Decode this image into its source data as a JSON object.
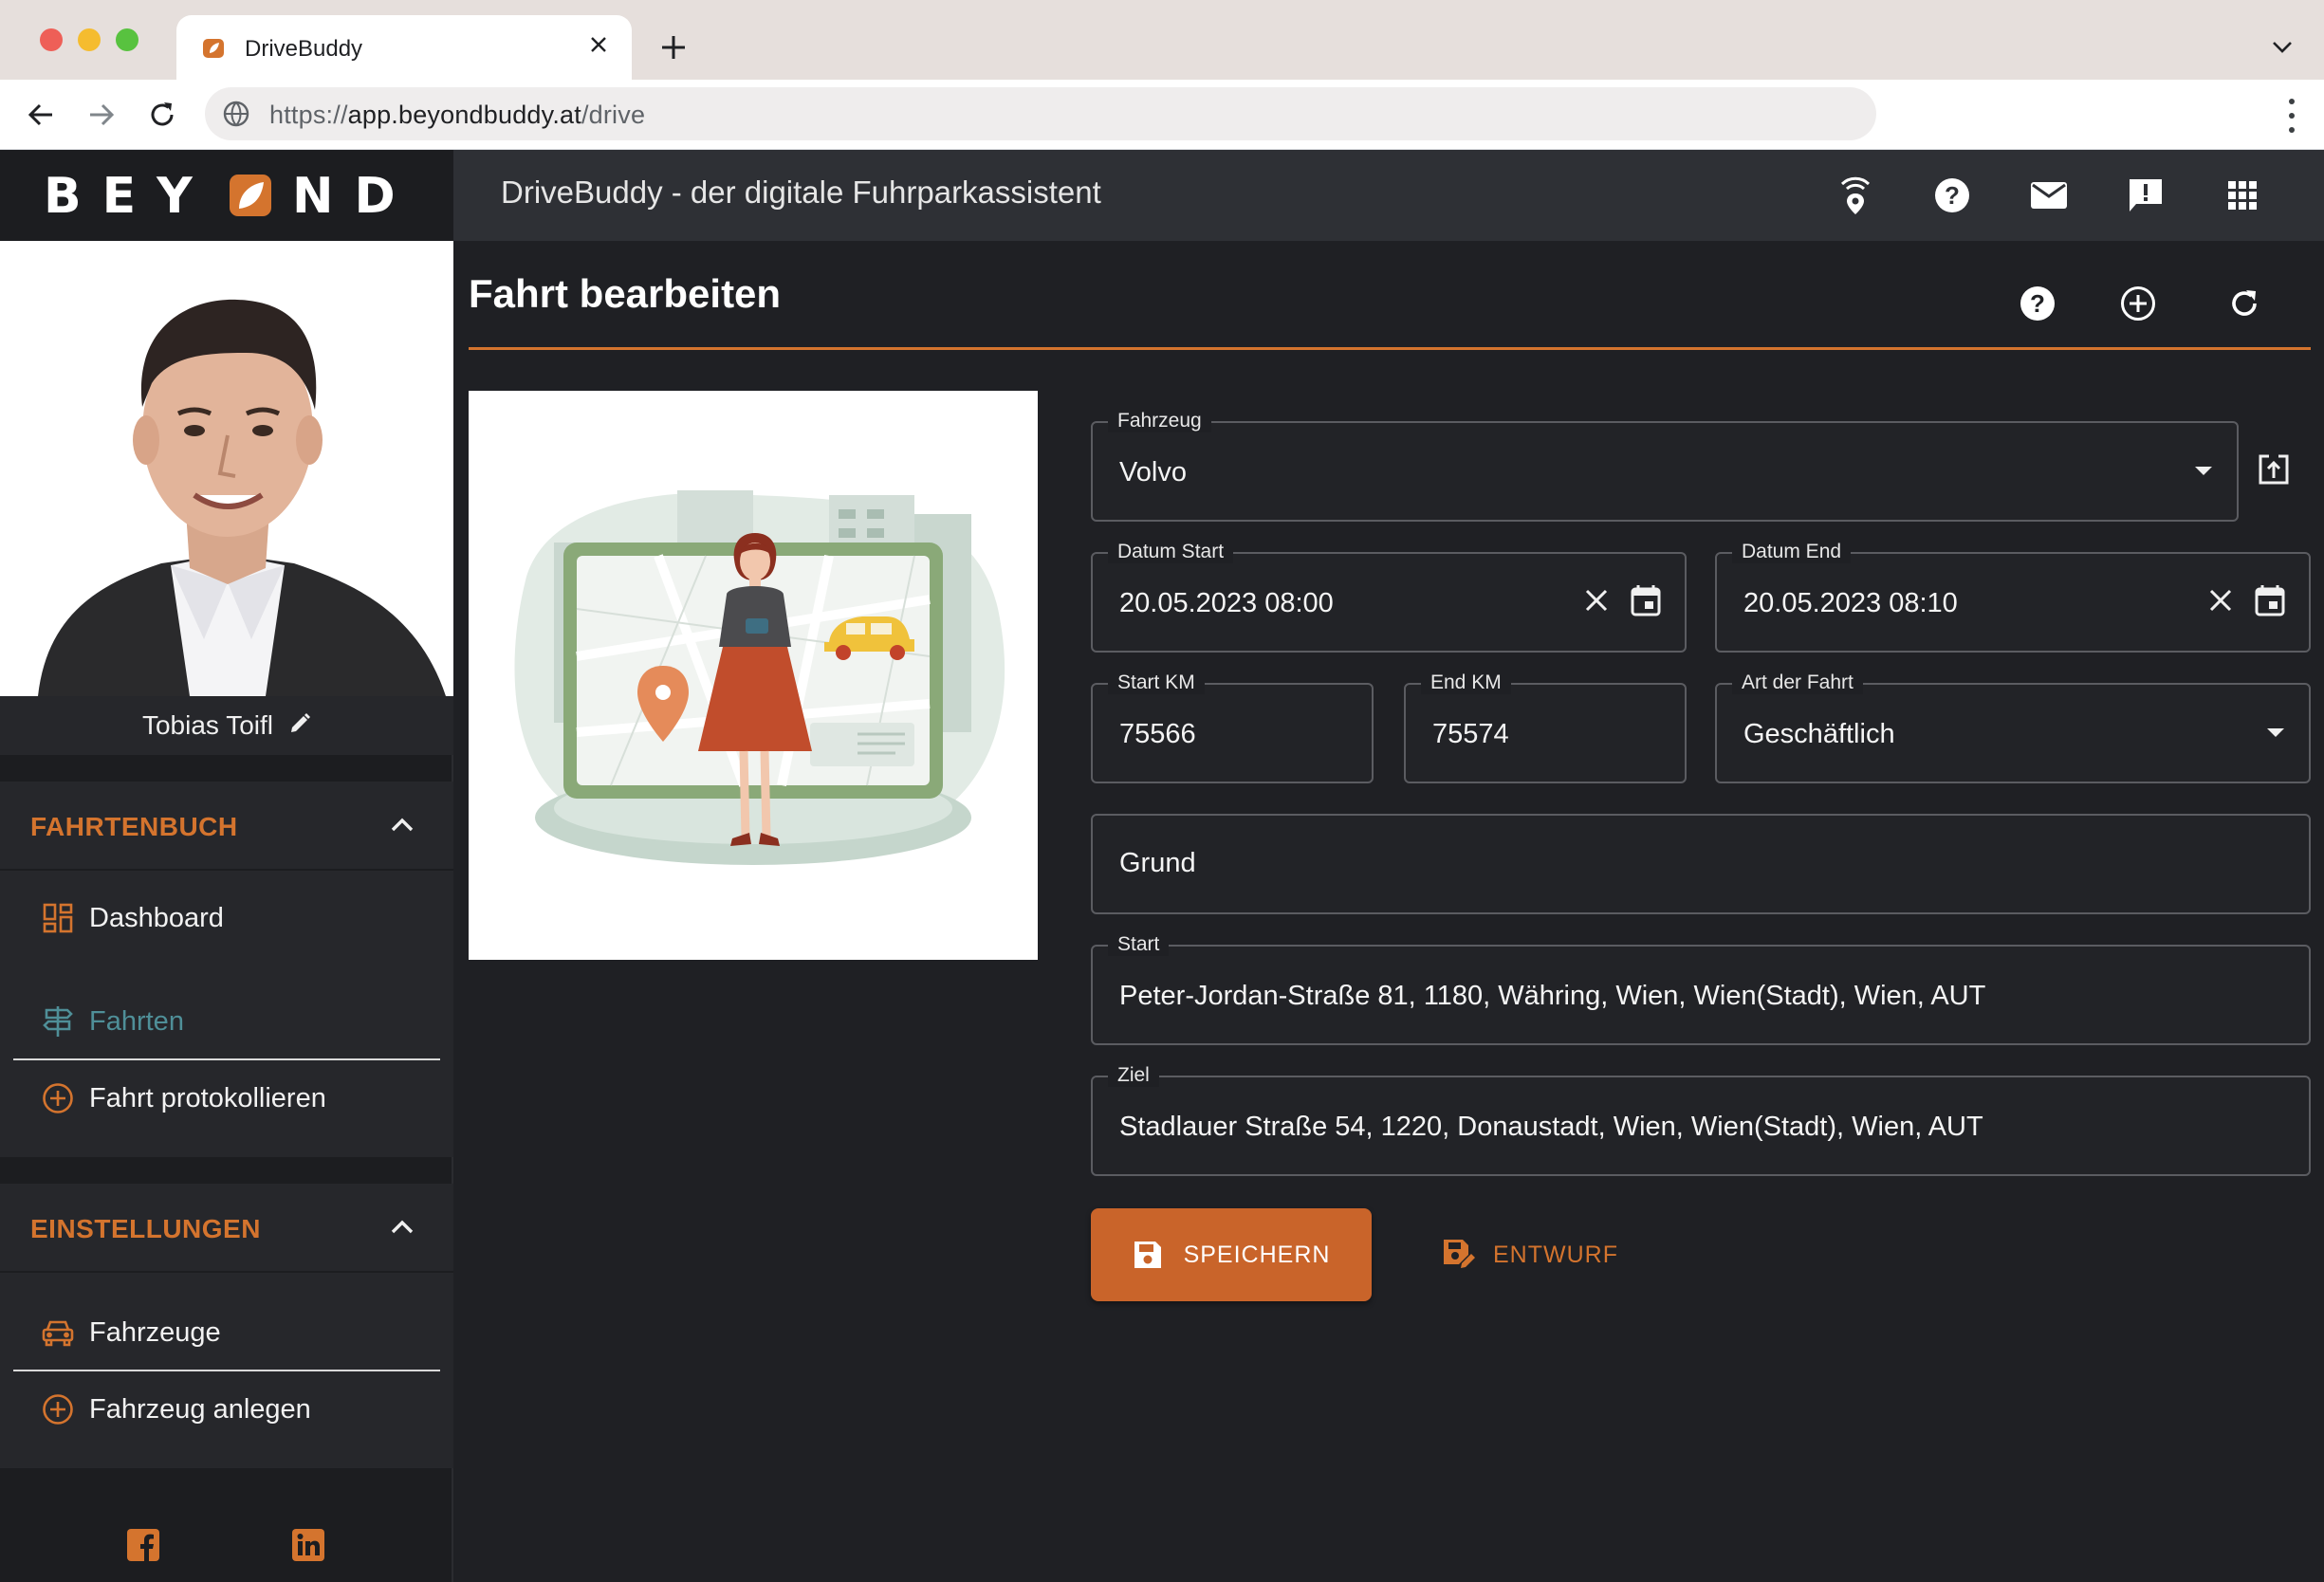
{
  "browser": {
    "tab_title": "DriveBuddy",
    "url_scheme": "https://",
    "url_host": "app.beyondbuddy.at",
    "url_path": "/drive"
  },
  "app": {
    "logo_text": "BEYOND",
    "title": "DriveBuddy - der digitale Fuhrparkassistent",
    "accent_color": "#d4742e",
    "header_icons": [
      "beacon-icon",
      "help-icon",
      "mail-icon",
      "feedback-icon",
      "apps-grid-icon"
    ]
  },
  "sidebar": {
    "user_name": "Tobias Toifl",
    "sections": [
      {
        "title": "FAHRTENBUCH",
        "items": [
          {
            "label": "Dashboard",
            "icon": "dashboard-icon"
          },
          {
            "label": "Fahrten",
            "icon": "signpost-icon",
            "active": true
          },
          {
            "label": "Fahrt protokollieren",
            "icon": "add-circle-icon"
          }
        ]
      },
      {
        "title": "EINSTELLUNGEN",
        "items": [
          {
            "label": "Fahrzeuge",
            "icon": "car-icon"
          },
          {
            "label": "Fahrzeug anlegen",
            "icon": "add-circle-icon"
          }
        ]
      }
    ],
    "social": [
      "facebook-icon",
      "linkedin-icon"
    ]
  },
  "page": {
    "title": "Fahrt bearbeiten",
    "actions": [
      "help-icon",
      "add-icon",
      "refresh-icon"
    ]
  },
  "form": {
    "vehicle": {
      "label": "Fahrzeug",
      "value": "Volvo"
    },
    "date_start": {
      "label": "Datum Start",
      "value": "20.05.2023 08:00"
    },
    "date_end": {
      "label": "Datum End",
      "value": "20.05.2023 08:10"
    },
    "start_km": {
      "label": "Start KM",
      "value": "75566"
    },
    "end_km": {
      "label": "End KM",
      "value": "75574"
    },
    "trip_type": {
      "label": "Art der Fahrt",
      "value": "Geschäftlich"
    },
    "reason": {
      "placeholder": "Grund"
    },
    "start": {
      "label": "Start",
      "value": "Peter-Jordan-Straße 81, 1180, Währing, Wien, Wien(Stadt), Wien, AUT"
    },
    "destination": {
      "label": "Ziel",
      "value": "Stadlauer Straße 54, 1220, Donaustadt, Wien, Wien(Stadt), Wien, AUT"
    },
    "save_label": "SPEICHERN",
    "draft_label": "ENTWURF"
  }
}
